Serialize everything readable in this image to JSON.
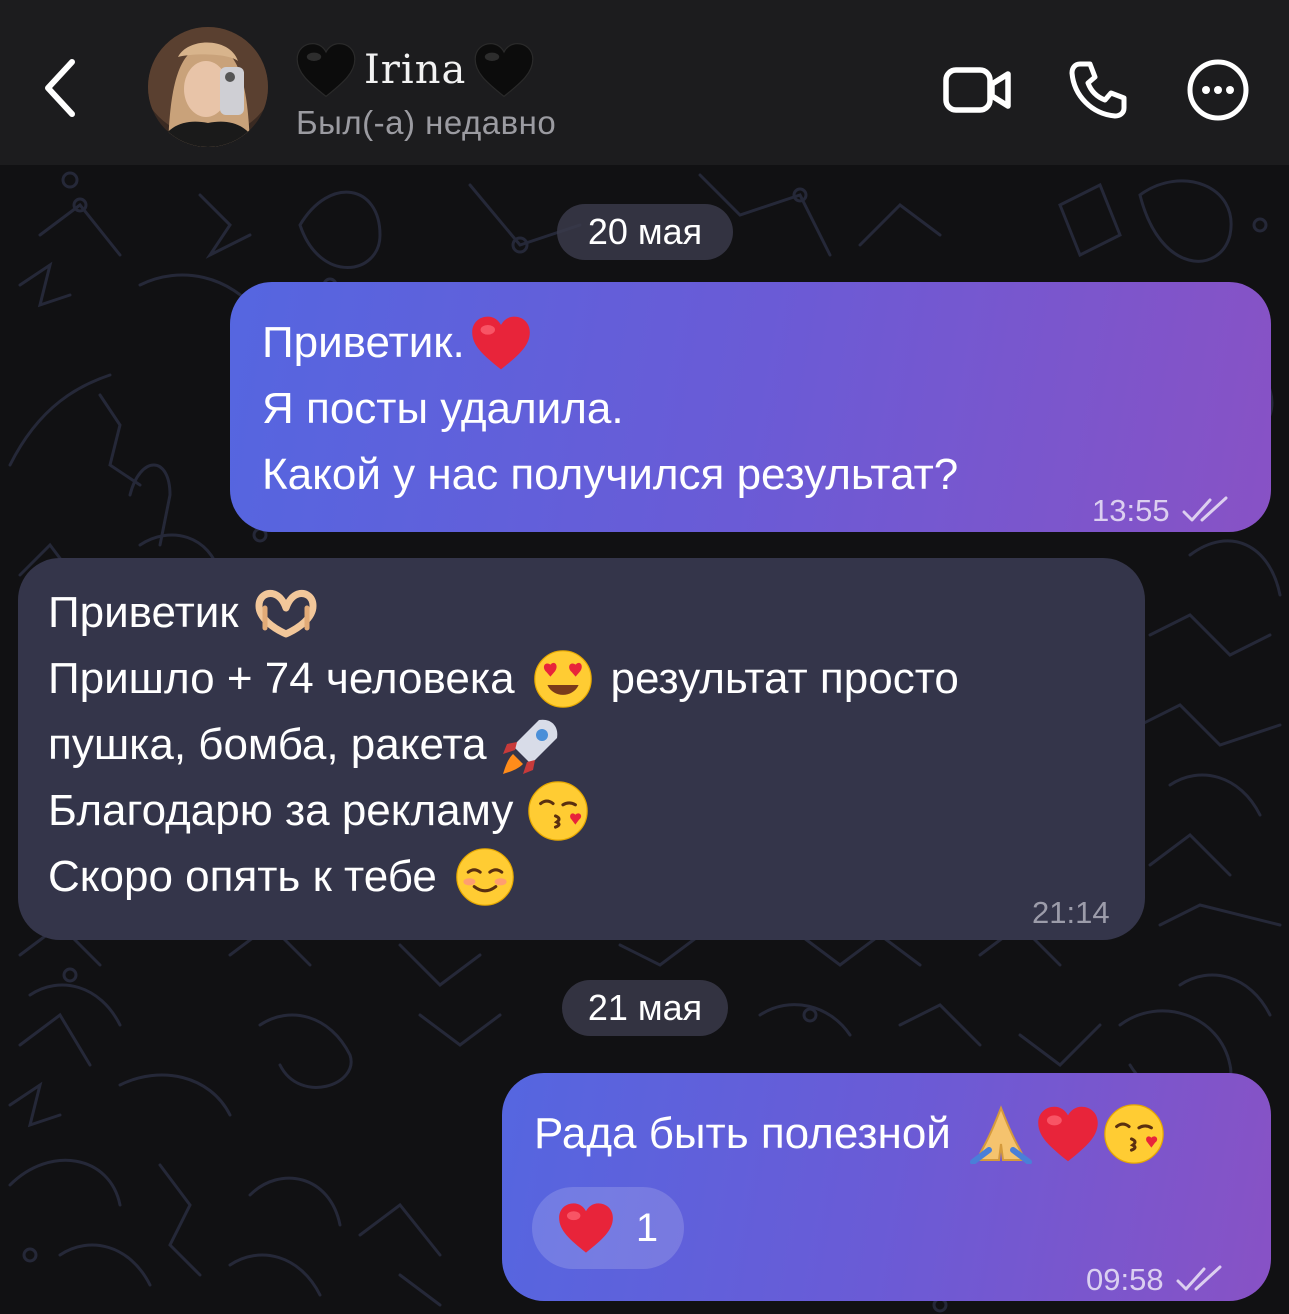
{
  "header": {
    "contact_name": "Irina",
    "status": "Был(-а) недавно"
  },
  "chat": {
    "dates": [
      "20 мая",
      "21 мая"
    ],
    "messages": [
      {
        "direction": "outgoing",
        "lines": [
          "Приветик.",
          "Я посты удалила.",
          "Какой у нас получился результат?"
        ],
        "time": "13:55",
        "read": true
      },
      {
        "direction": "incoming",
        "lines": [
          "Приветик",
          "Пришло + 74 человека",
          "результат просто",
          "пушка, бомба, ракета",
          "Благодарю за рекламу",
          "Скоро опять к тебе"
        ],
        "time": "21:14"
      },
      {
        "direction": "outgoing",
        "lines": [
          "Рада быть полезной"
        ],
        "time": "09:58",
        "read": true,
        "reaction": {
          "icon": "red-heart",
          "count": "1"
        }
      }
    ]
  },
  "colors": {
    "background": "#111113",
    "header": "#1c1c1e",
    "outgoing_gradient": [
      "#5566e0",
      "#8852c5"
    ],
    "incoming": "#34354a",
    "heart": "#e8243a"
  },
  "icons": [
    "chevron-left-icon",
    "video-call-icon",
    "phone-icon",
    "more-icon",
    "black-heart-icon",
    "red-heart-icon",
    "heart-hands-icon",
    "heart-eyes-icon",
    "rocket-icon",
    "kiss-icon",
    "smiling-icon",
    "praying-hands-icon",
    "double-check-icon"
  ]
}
